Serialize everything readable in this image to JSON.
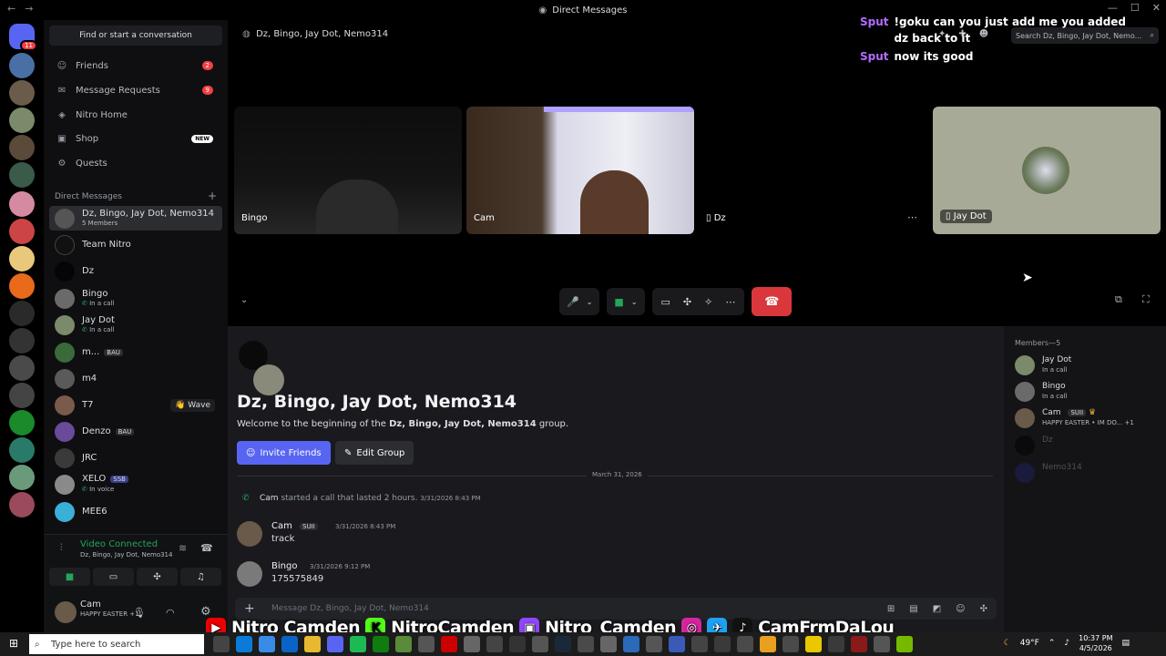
{
  "window": {
    "title": "Direct Messages"
  },
  "sidebar": {
    "search_placeholder": "Find or start a conversation",
    "nav": [
      {
        "label": "Friends",
        "badge": "2"
      },
      {
        "label": "Message Requests",
        "badge": "9"
      },
      {
        "label": "Nitro Home",
        "badge": ""
      },
      {
        "label": "Shop",
        "badge": "NEW"
      },
      {
        "label": "Quests",
        "badge": ""
      }
    ],
    "dm_header": "Direct Messages",
    "dms": [
      {
        "name": "Dz, Bingo, Jay Dot, Nemo314",
        "sub": "5 Members",
        "tag": "",
        "extra": ""
      },
      {
        "name": "Team Nitro",
        "sub": "",
        "tag": "",
        "extra": ""
      },
      {
        "name": "Dz",
        "sub": "",
        "tag": "",
        "extra": ""
      },
      {
        "name": "Bingo",
        "sub": "In a call",
        "tag": "",
        "extra": ""
      },
      {
        "name": "Jay Dot",
        "sub": "In a call",
        "tag": "",
        "extra": ""
      },
      {
        "name": "m...",
        "sub": "",
        "tag": "BAU",
        "extra": ""
      },
      {
        "name": "m4",
        "sub": "",
        "tag": "",
        "extra": ""
      },
      {
        "name": "T7",
        "sub": "",
        "tag": "",
        "extra": "Wave"
      },
      {
        "name": "Denzo",
        "sub": "",
        "tag": "BAU",
        "extra": ""
      },
      {
        "name": "JRC",
        "sub": "",
        "tag": "",
        "extra": ""
      },
      {
        "name": "XELO",
        "sub": "In voice",
        "tag": "SSB",
        "extra": ""
      },
      {
        "name": "MEE6",
        "sub": "",
        "tag": "",
        "extra": ""
      }
    ]
  },
  "voice": {
    "status": "Video Connected",
    "channel": "Dz, Bingo, Jay Dot, Nemo314"
  },
  "user": {
    "name": "Cam",
    "status": "HAPPY EASTER",
    "extra": "+1"
  },
  "call": {
    "header": "Dz, Bingo, Jay Dot, Nemo314",
    "tiles": [
      {
        "label": "Bingo"
      },
      {
        "label": "Cam"
      },
      {
        "label": "Dz"
      },
      {
        "label": "Jay Dot"
      }
    ]
  },
  "overlay_chat": [
    {
      "who": "Sput",
      "text": "!goku can you just add me you added dz back to it"
    },
    {
      "who": "Sput",
      "text": "now its good"
    }
  ],
  "top_search": "Search Dz, Bingo, Jay Dot, Nemo...",
  "chat": {
    "title": "Dz, Bingo, Jay Dot, Nemo314",
    "welcome_pre": "Welcome to the beginning of the ",
    "welcome_group": "Dz, Bingo, Jay Dot, Nemo314",
    "welcome_post": " group.",
    "invite_label": "Invite Friends",
    "edit_label": "Edit Group",
    "date": "March 31, 2026",
    "system": {
      "name": "Cam",
      "text": " started a call that lasted 2 hours.",
      "time": "3/31/2026 8:43 PM"
    },
    "messages": [
      {
        "author": "Cam",
        "tag": "SUII",
        "time": "3/31/2026 8:43 PM",
        "text": "track"
      },
      {
        "author": "Bingo",
        "tag": "",
        "time": "3/31/2026 9:12 PM",
        "text": "175575849"
      }
    ],
    "composer_placeholder": "Message Dz, Bingo, Jay Dot, Nemo314"
  },
  "members": {
    "header": "Members—5",
    "list": [
      {
        "name": "Jay Dot",
        "sub": "In a call"
      },
      {
        "name": "Bingo",
        "sub": "In a call"
      },
      {
        "name": "Cam",
        "sub": "HAPPY EASTER • IM DO... +1"
      },
      {
        "name": "Dz",
        "sub": ""
      },
      {
        "name": "Nemo314",
        "sub": ""
      }
    ]
  },
  "banner": {
    "youtube": "Nitro Camden",
    "kick": "NitroCamden",
    "twitch": "Nitro_Camden",
    "socials": "CamFrmDaLou"
  },
  "taskbar": {
    "search": "Type here to search",
    "temp": "49°F",
    "time": "10:37 PM",
    "date": "4/5/2026"
  },
  "colors": {
    "blurple": "#5865f2",
    "end_call": "#da373c",
    "overlay_name": "#b36bff",
    "online": "#23a55a",
    "badge": "#f23f43"
  }
}
